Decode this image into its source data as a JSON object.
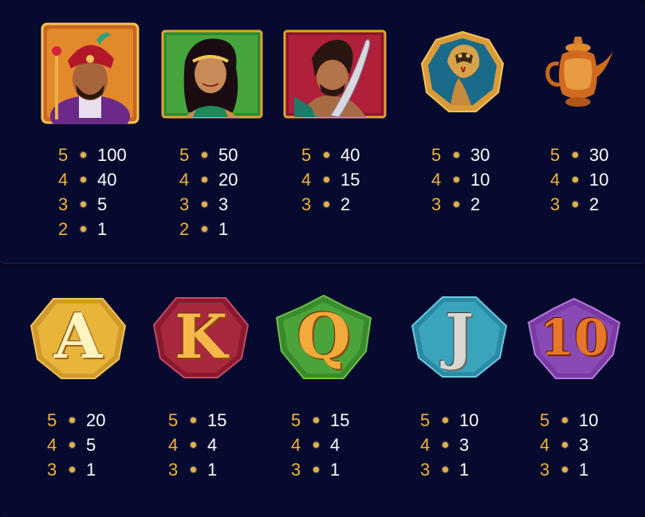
{
  "colors": {
    "background": "#070826",
    "count_color": "#f0b43a",
    "value_color": "#ffffff"
  },
  "top_symbols": [
    {
      "name": "sultan",
      "pays": [
        {
          "count": "5",
          "value": "100"
        },
        {
          "count": "4",
          "value": "40"
        },
        {
          "count": "3",
          "value": "5"
        },
        {
          "count": "2",
          "value": "1"
        }
      ]
    },
    {
      "name": "princess",
      "pays": [
        {
          "count": "5",
          "value": "50"
        },
        {
          "count": "4",
          "value": "20"
        },
        {
          "count": "3",
          "value": "3"
        },
        {
          "count": "2",
          "value": "1"
        }
      ]
    },
    {
      "name": "warrior",
      "pays": [
        {
          "count": "5",
          "value": "40"
        },
        {
          "count": "4",
          "value": "15"
        },
        {
          "count": "3",
          "value": "2"
        }
      ]
    },
    {
      "name": "cobra",
      "pays": [
        {
          "count": "5",
          "value": "30"
        },
        {
          "count": "4",
          "value": "10"
        },
        {
          "count": "3",
          "value": "2"
        }
      ]
    },
    {
      "name": "teapot",
      "pays": [
        {
          "count": "5",
          "value": "30"
        },
        {
          "count": "4",
          "value": "10"
        },
        {
          "count": "3",
          "value": "2"
        }
      ]
    }
  ],
  "bottom_symbols": [
    {
      "name": "A",
      "letter": "A",
      "pays": [
        {
          "count": "5",
          "value": "20"
        },
        {
          "count": "4",
          "value": "5"
        },
        {
          "count": "3",
          "value": "1"
        }
      ]
    },
    {
      "name": "K",
      "letter": "K",
      "pays": [
        {
          "count": "5",
          "value": "15"
        },
        {
          "count": "4",
          "value": "4"
        },
        {
          "count": "3",
          "value": "1"
        }
      ]
    },
    {
      "name": "Q",
      "letter": "Q",
      "pays": [
        {
          "count": "5",
          "value": "15"
        },
        {
          "count": "4",
          "value": "4"
        },
        {
          "count": "3",
          "value": "1"
        }
      ]
    },
    {
      "name": "J",
      "letter": "J",
      "pays": [
        {
          "count": "5",
          "value": "10"
        },
        {
          "count": "4",
          "value": "3"
        },
        {
          "count": "3",
          "value": "1"
        }
      ]
    },
    {
      "name": "10",
      "letter": "10",
      "pays": [
        {
          "count": "5",
          "value": "10"
        },
        {
          "count": "4",
          "value": "3"
        },
        {
          "count": "3",
          "value": "1"
        }
      ]
    }
  ]
}
